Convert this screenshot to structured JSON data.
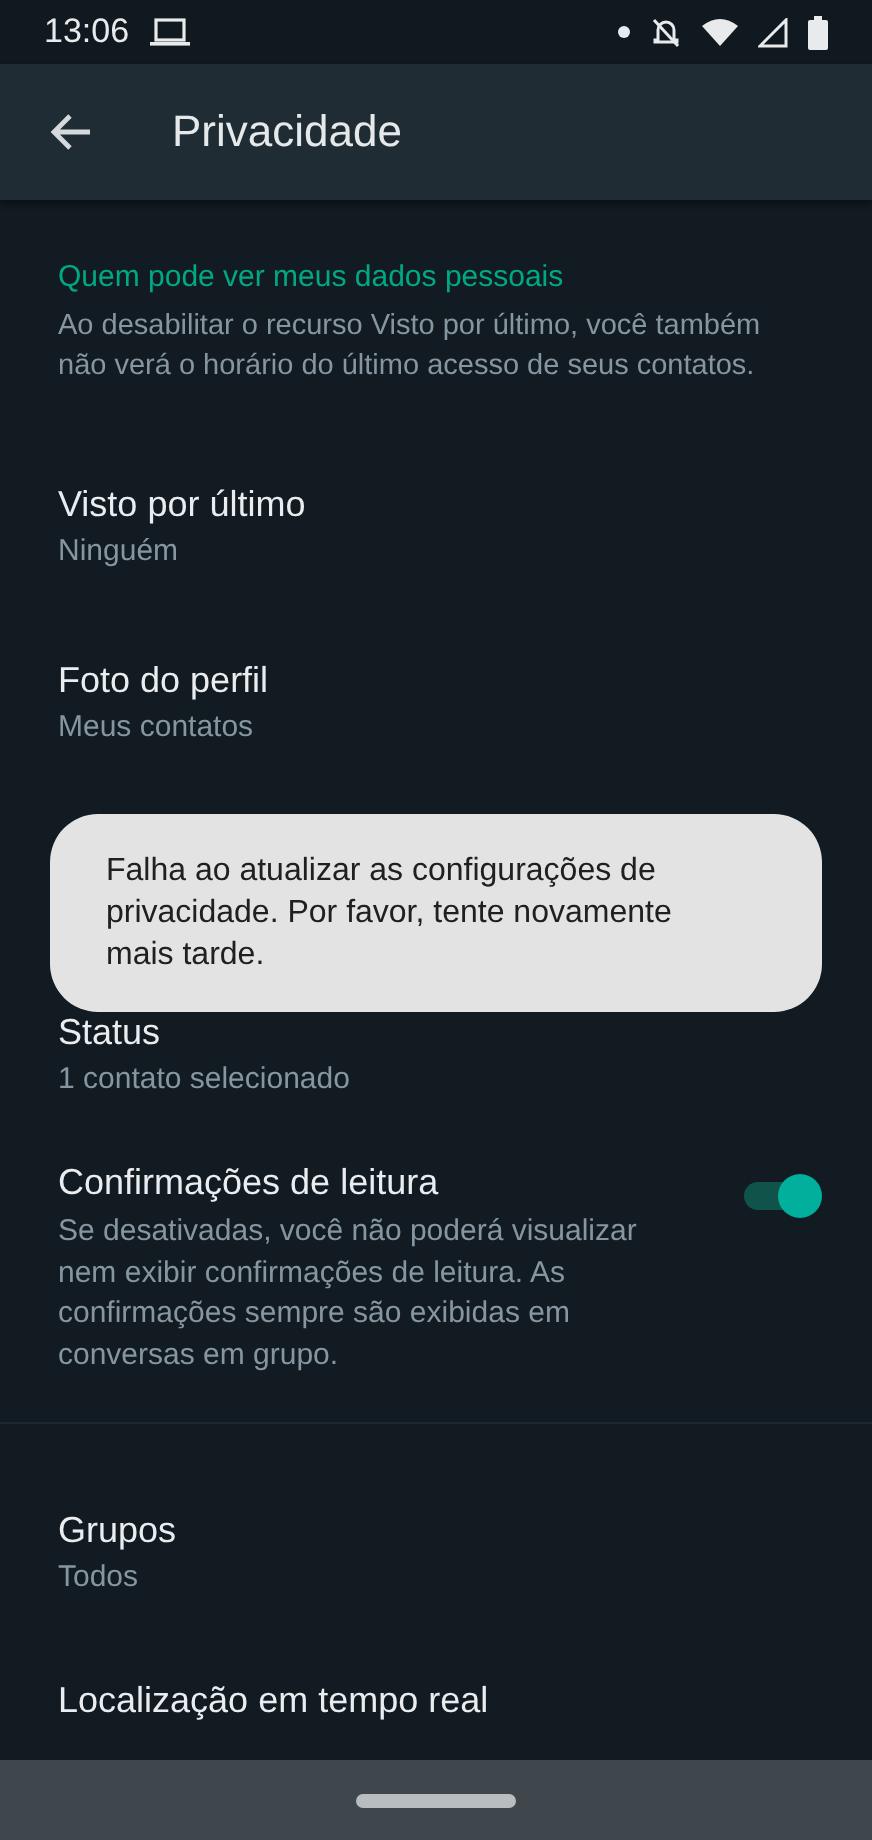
{
  "status_bar": {
    "time": "13:06"
  },
  "app_bar": {
    "title": "Privacidade"
  },
  "section": {
    "header": "Quem pode ver meus dados pessoais",
    "description": "Ao desabilitar o recurso Visto por último, você também não verá o horário do último acesso de seus contatos."
  },
  "settings": [
    {
      "kind": "option",
      "title": "Visto por último",
      "value": "Ninguém"
    },
    {
      "kind": "option",
      "title": "Foto do perfil",
      "value": "Meus contatos"
    },
    {
      "kind": "hidden"
    },
    {
      "kind": "option",
      "title": "Status",
      "value": "1 contato selecionado"
    },
    {
      "kind": "toggle",
      "title": "Confirmações de leitura",
      "description": "Se desativadas, você não poderá visualizar nem exibir confirmações de leitura. As confirmações sempre são exibidas em conversas em grupo.",
      "on": true
    },
    {
      "kind": "divider"
    },
    {
      "kind": "option",
      "title": "Grupos",
      "value": "Todos"
    },
    {
      "kind": "option",
      "title": "Localização em tempo real"
    }
  ],
  "toast": {
    "message": "Falha ao atualizar as configurações de privacidade. Por favor, tente novamente mais tarde."
  }
}
